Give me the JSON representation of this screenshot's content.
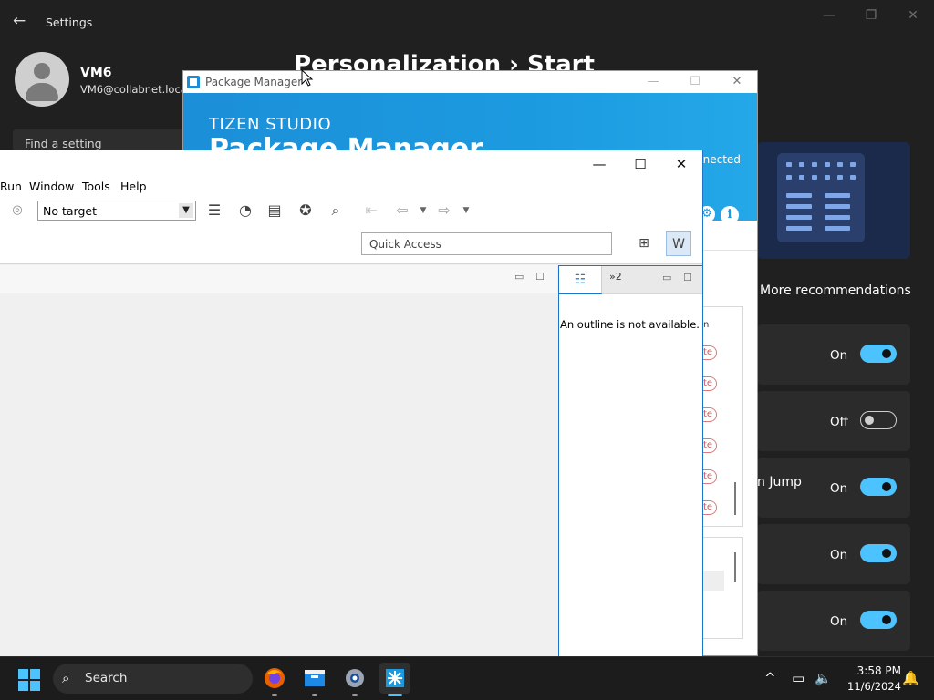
{
  "settings": {
    "title": "Settings",
    "back_icon": "back-arrow-icon",
    "user_name": "VM6",
    "user_email": "VM6@collabnet.loca",
    "find_placeholder": "Find a setting",
    "breadcrumb": "Personalization  ›  Start",
    "more_recommendations": "More recommendations",
    "rows": [
      {
        "text": "",
        "state": "On",
        "on": true
      },
      {
        "text": "",
        "state": "Off",
        "on": false
      },
      {
        "text": "n Jump",
        "state": "On",
        "on": true
      },
      {
        "text": "",
        "state": "On",
        "on": true
      },
      {
        "text": "",
        "state": "On",
        "on": true
      }
    ]
  },
  "package_manager": {
    "title": "Package Manager",
    "brand": "TIZEN STUDIO",
    "product": "Package Manager",
    "status": "nnected"
  },
  "eclipse": {
    "menu": [
      "Run",
      "Window",
      "Tools",
      "Help"
    ],
    "target": "No target",
    "quick_access_placeholder": "Quick Access",
    "outline_tab2": "»2",
    "outline_message": "An outline is not available."
  },
  "taskbar": {
    "search_label": "Search",
    "time": "3:58 PM",
    "date": "11/6/2024",
    "accent": "#4cc2ff"
  }
}
